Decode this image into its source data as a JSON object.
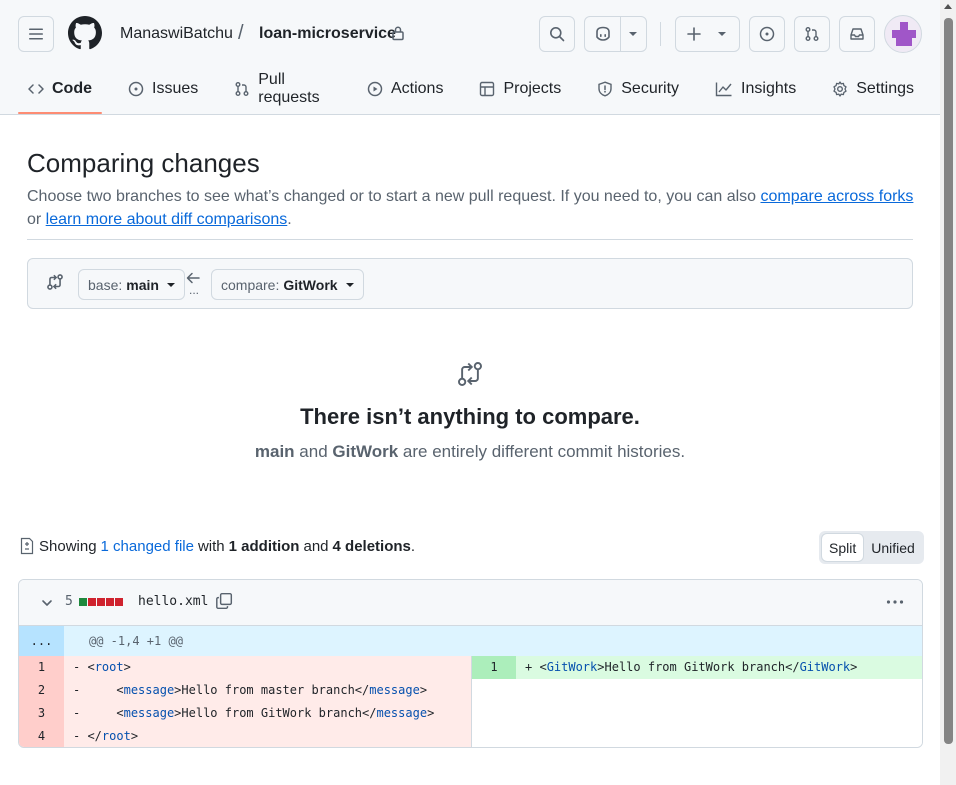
{
  "header": {
    "owner": "ManaswiBatchu",
    "separator": "/",
    "repo": "loan-microservice"
  },
  "nav": {
    "tabs": [
      {
        "label": "Code",
        "icon": "code-icon",
        "selected": true
      },
      {
        "label": "Issues",
        "icon": "issue-opened-icon"
      },
      {
        "label": "Pull requests",
        "icon": "git-pull-request-icon"
      },
      {
        "label": "Actions",
        "icon": "play-icon"
      },
      {
        "label": "Projects",
        "icon": "table-icon"
      },
      {
        "label": "Security",
        "icon": "shield-icon"
      },
      {
        "label": "Insights",
        "icon": "graph-icon"
      },
      {
        "label": "Settings",
        "icon": "gear-icon"
      }
    ]
  },
  "compare": {
    "title": "Comparing changes",
    "desc_prefix": "Choose two branches to see what’s changed or to start a new pull request. If you need to, you can also ",
    "link_forks": "compare across forks",
    "desc_mid": " or ",
    "link_learn": "learn more about diff comparisons",
    "desc_suffix": ".",
    "base_label": "base:",
    "base_value": "main",
    "compare_label": "compare:",
    "compare_value": "GitWork",
    "dots": "..."
  },
  "blankslate": {
    "title": "There isn’t anything to compare.",
    "branch_a": "main",
    "and": " and ",
    "branch_b": "GitWork",
    "rest": " are entirely different commit histories."
  },
  "summary": {
    "showing": "Showing",
    "changed_files": "1 changed file",
    "with": "with",
    "additions": "1 addition",
    "and": "and",
    "deletions": "4 deletions",
    "period": ".",
    "split": "Split",
    "unified": "Unified"
  },
  "file": {
    "changes": "5",
    "name": "hello.xml",
    "diffstat_colors": [
      "#1f883d",
      "#cf222e",
      "#cf222e",
      "#cf222e",
      "#cf222e"
    ],
    "hunk_expand": "...",
    "hunk_header": "@@ -1,4 +1 @@",
    "deleted": [
      {
        "num": "1",
        "prefix": "- ",
        "indent": "",
        "open": "<",
        "tag": "root",
        "close": ">",
        "text": "",
        "endtag": ""
      },
      {
        "num": "2",
        "prefix": "- ",
        "indent": "    ",
        "open": "<",
        "tag": "message",
        "close": ">",
        "text": "Hello from master branch",
        "endtag": "message"
      },
      {
        "num": "3",
        "prefix": "- ",
        "indent": "    ",
        "open": "<",
        "tag": "message",
        "close": ">",
        "text": "Hello from GitWork branch",
        "endtag": "message"
      },
      {
        "num": "4",
        "prefix": "- ",
        "indent": "",
        "open": "</",
        "tag": "root",
        "close": ">",
        "text": "",
        "endtag": ""
      }
    ],
    "added": [
      {
        "num": "1",
        "prefix": "+ ",
        "tag": "GitWork",
        "text": "Hello from GitWork branch",
        "endtag": "GitWork"
      }
    ]
  }
}
